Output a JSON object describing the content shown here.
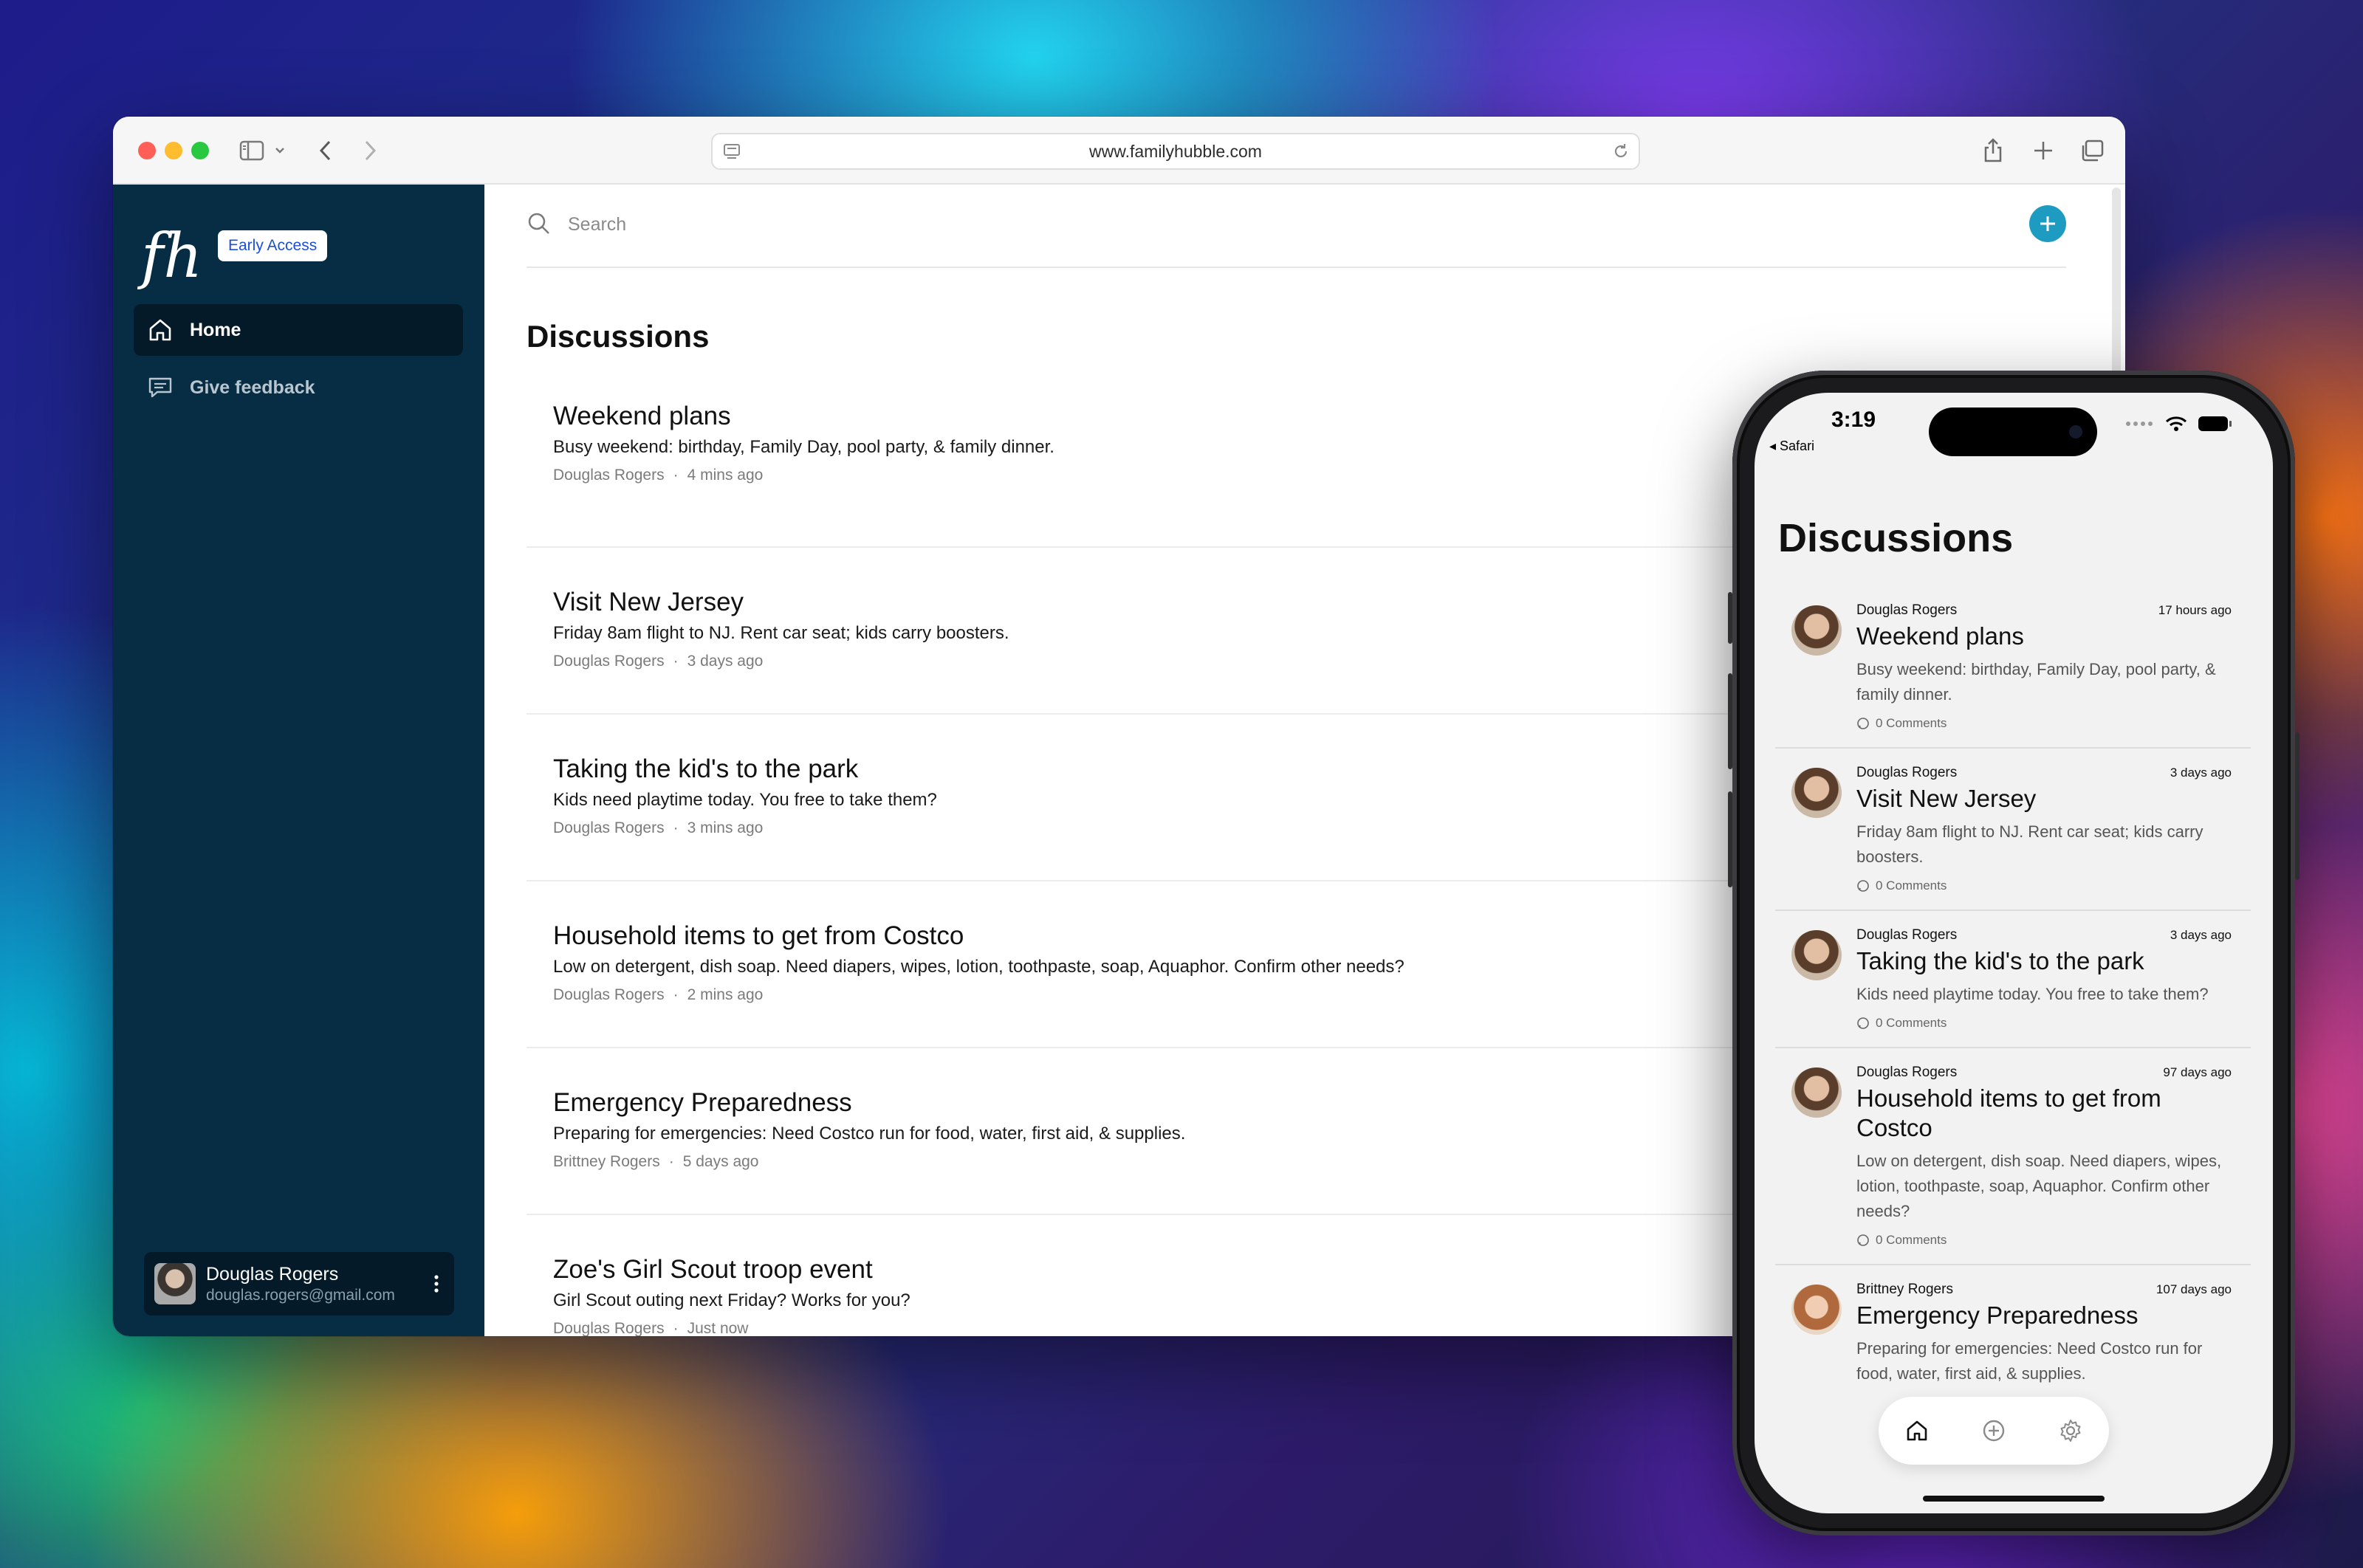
{
  "browser": {
    "url": "www.familyhubble.com"
  },
  "app": {
    "logo_text": "fh",
    "badge": "Early Access",
    "nav": [
      {
        "label": "Home",
        "icon": "home-icon"
      },
      {
        "label": "Give feedback",
        "icon": "chat-icon"
      }
    ],
    "user": {
      "name": "Douglas Rogers",
      "email": "douglas.rogers@gmail.com"
    }
  },
  "main": {
    "search_placeholder": "Search",
    "title": "Discussions",
    "discussions": [
      {
        "title": "Weekend plans",
        "desc": "Busy weekend: birthday, Family Day, pool party, & family dinner.",
        "author": "Douglas Rogers",
        "time": "4 mins ago"
      },
      {
        "title": "Visit New Jersey",
        "desc": "Friday 8am flight to NJ. Rent car seat; kids carry boosters.",
        "author": "Douglas Rogers",
        "time": "3 days ago"
      },
      {
        "title": "Taking the kid's to the park",
        "desc": "Kids need playtime today. You free to take them?",
        "author": "Douglas Rogers",
        "time": "3 mins ago"
      },
      {
        "title": "Household items to get from Costco",
        "desc": "Low on detergent, dish soap. Need diapers, wipes, lotion, toothpaste, soap, Aquaphor. Confirm other needs?",
        "author": "Douglas Rogers",
        "time": "2 mins ago"
      },
      {
        "title": "Emergency Preparedness",
        "desc": "Preparing for emergencies: Need Costco run for food, water, first aid, & supplies.",
        "author": "Brittney Rogers",
        "time": "5 days ago"
      },
      {
        "title": "Zoe's Girl Scout troop event",
        "desc": "Girl Scout outing next Friday? Works for you?",
        "author": "Douglas Rogers",
        "time": "Just now"
      }
    ],
    "meta_separator": "·"
  },
  "phone": {
    "time": "3:19",
    "back_label": "◂ Safari",
    "title": "Discussions",
    "items": [
      {
        "author": "Douglas Rogers",
        "time": "17 hours ago",
        "title": "Weekend plans",
        "desc": "Busy weekend: birthday, Family Day, pool party, & family dinner.",
        "comments": "0 Comments"
      },
      {
        "author": "Douglas Rogers",
        "time": "3 days ago",
        "title": "Visit New Jersey",
        "desc": "Friday 8am flight to NJ. Rent car seat; kids carry boosters.",
        "comments": "0 Comments"
      },
      {
        "author": "Douglas Rogers",
        "time": "3 days ago",
        "title": "Taking the kid's to the park",
        "desc": "Kids need playtime today. You free to take them?",
        "comments": "0 Comments"
      },
      {
        "author": "Douglas Rogers",
        "time": "97 days ago",
        "title": "Household items to get from Costco",
        "desc": "Low on detergent, dish soap. Need diapers, wipes, lotion, toothpaste, soap, Aquaphor. Confirm other needs?",
        "comments": "0 Comments"
      },
      {
        "author": "Brittney Rogers",
        "time": "107 days ago",
        "title": "Emergency Preparedness",
        "desc": "Preparing for emergencies: Need Costco run for food, water, first aid, & supplies.",
        "comments": ""
      }
    ],
    "tabs": [
      "home-icon",
      "plus-circle-icon",
      "gear-icon"
    ]
  },
  "colors": {
    "sidebar_bg": "#072d44",
    "sidebar_active": "#041a28",
    "accent": "#1e9bc0",
    "badge_text": "#1d4ed8"
  }
}
